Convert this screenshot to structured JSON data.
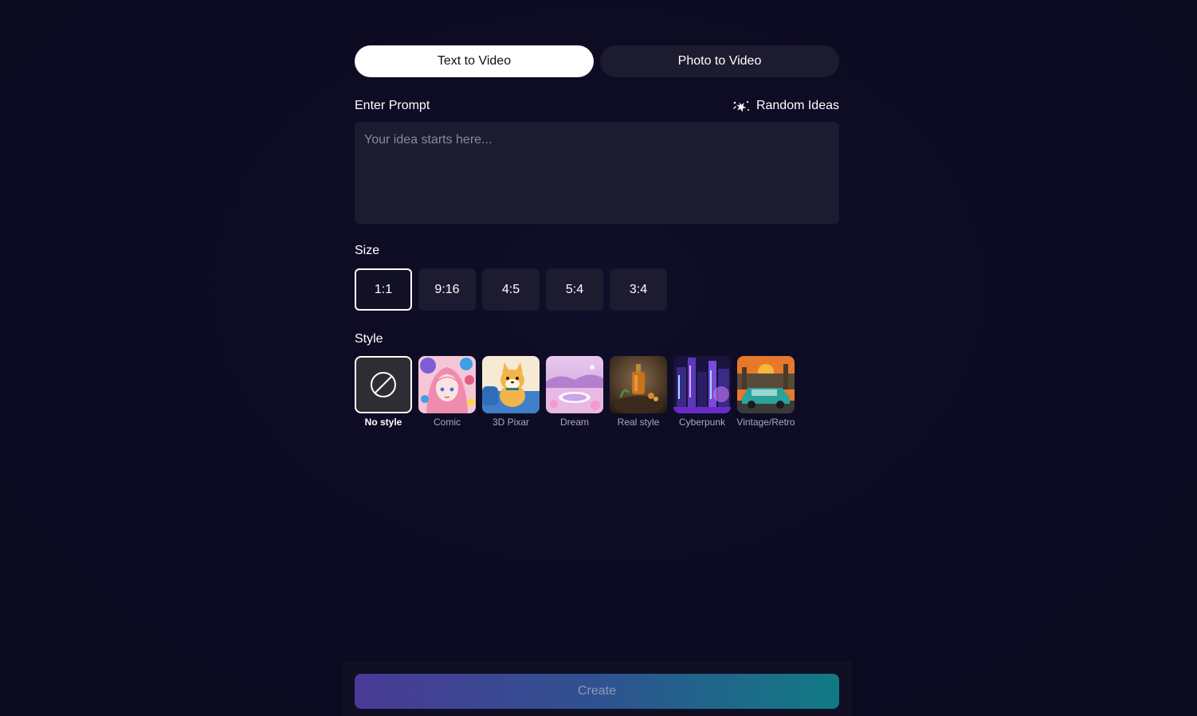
{
  "tabs": [
    {
      "label": "Text to Video",
      "active": true
    },
    {
      "label": "Photo to Video",
      "active": false
    }
  ],
  "prompt": {
    "label": "Enter Prompt",
    "random_label": "Random Ideas",
    "random_icon": "sparkle-dice-icon",
    "placeholder": "Your idea starts here...",
    "value": ""
  },
  "size": {
    "label": "Size",
    "options": [
      "1:1",
      "9:16",
      "4:5",
      "5:4",
      "3:4"
    ],
    "selected": "1:1"
  },
  "style": {
    "label": "Style",
    "options": [
      {
        "name": "No style",
        "icon": "no-style-icon",
        "selected": true
      },
      {
        "name": "Comic",
        "selected": false
      },
      {
        "name": "3D Pixar",
        "selected": false
      },
      {
        "name": "Dream",
        "selected": false
      },
      {
        "name": "Real style",
        "selected": false
      },
      {
        "name": "Cyberpunk",
        "selected": false
      },
      {
        "name": "Vintage/Retro",
        "selected": false
      }
    ]
  },
  "create": {
    "label": "Create"
  },
  "colors": {
    "background": "#0d0b22",
    "surface": "#1c1b2f",
    "gradient_start": "#4a3a96",
    "gradient_end": "#117a84"
  }
}
